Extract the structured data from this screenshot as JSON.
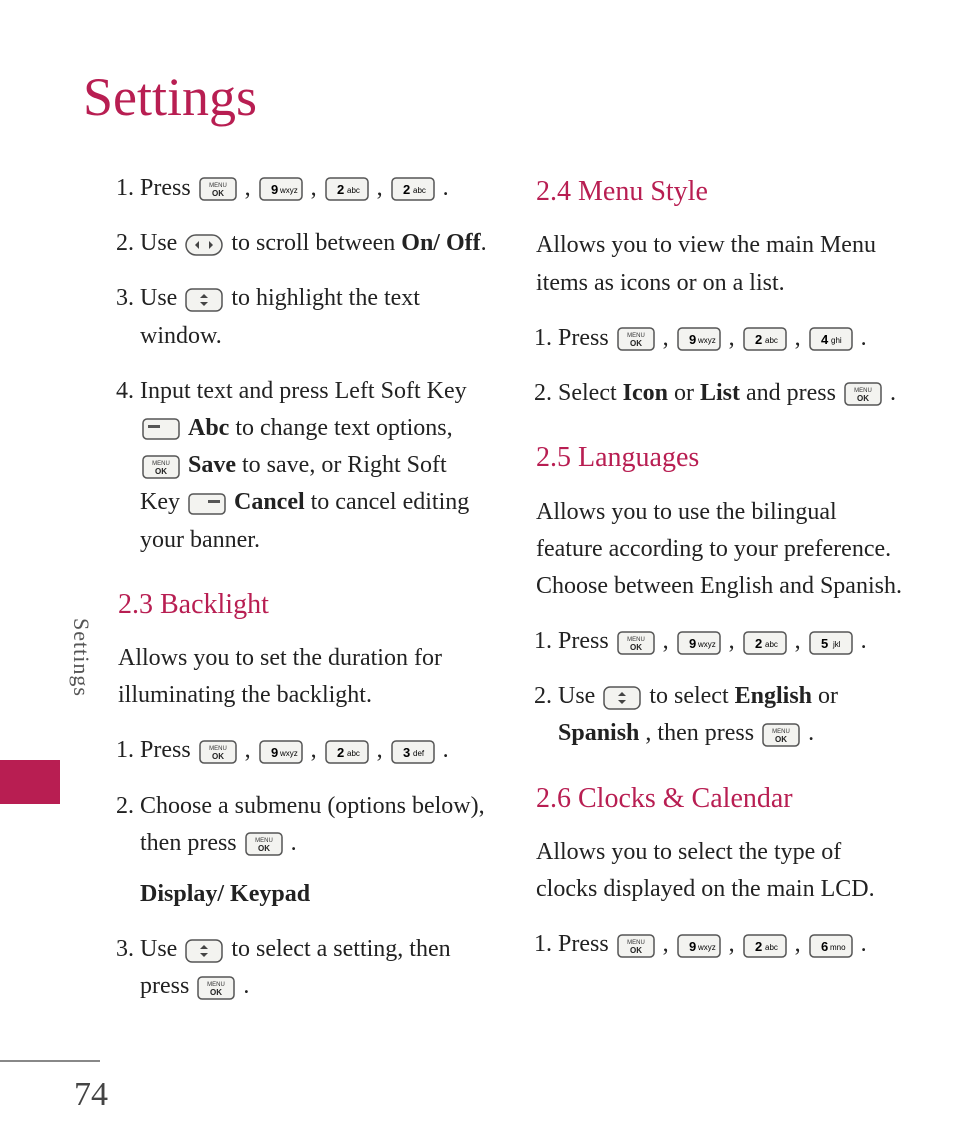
{
  "page": {
    "title": "Settings",
    "sidebar_label": "Settings",
    "page_number": "74"
  },
  "col_left": {
    "steps_initial": {
      "s1_a": "Press ",
      "s1_b": " , ",
      "s1_c": " , ",
      "s1_d": " , ",
      "s1_e": " .",
      "s2_a": "Use ",
      "s2_b": " to scroll between ",
      "s2_bold": "On/ Off",
      "s2_c": ".",
      "s3_a": "Use ",
      "s3_b": " to highlight the text window.",
      "s4_a": "Input text and press Left Soft Key ",
      "s4_b": " ",
      "s4_abc": "Abc",
      "s4_c": " to change text options, ",
      "s4_d": " ",
      "s4_save": "Save",
      "s4_e": " to save, or Right Soft Key ",
      "s4_f": " ",
      "s4_cancel": "Cancel",
      "s4_g": " to cancel editing your banner."
    },
    "sec_backlight": {
      "heading": "2.3 Backlight",
      "intro": "Allows you to set the duration for illuminating the backlight.",
      "s1_a": "Press ",
      "s1_b": " , ",
      "s1_c": " , ",
      "s1_d": " , ",
      "s1_e": " .",
      "s2_a": "Choose a submenu (options below), then press ",
      "s2_b": " .",
      "s2_sub": "Display/ Keypad",
      "s3_a": "Use ",
      "s3_b": " to select a setting, then press ",
      "s3_c": " ."
    }
  },
  "col_right": {
    "sec_menu": {
      "heading": "2.4 Menu Style",
      "intro": "Allows you to view the main Menu items as icons or on a list.",
      "s1_a": "Press ",
      "s1_b": " , ",
      "s1_c": " , ",
      "s1_d": " , ",
      "s1_e": " .",
      "s2_a": "Select ",
      "s2_icon": "Icon",
      "s2_or": " or ",
      "s2_list": "List",
      "s2_b": " and press ",
      "s2_c": " ."
    },
    "sec_lang": {
      "heading": "2.5 Languages",
      "intro": "Allows you to use the bilingual feature according to your preference. Choose between English and Spanish.",
      "s1_a": "Press ",
      "s1_b": " , ",
      "s1_c": " , ",
      "s1_d": " , ",
      "s1_e": " .",
      "s2_a": "Use ",
      "s2_b": " to select ",
      "s2_eng": "English",
      "s2_or": " or ",
      "s2_spa": "Spanish",
      "s2_c": ", then press ",
      "s2_d": " ."
    },
    "sec_clock": {
      "heading": "2.6 Clocks & Calendar",
      "intro": "Allows you to select the type of clocks displayed on the main LCD.",
      "s1_a": "Press ",
      "s1_b": " , ",
      "s1_c": " , ",
      "s1_d": " , ",
      "s1_e": " ."
    }
  },
  "keys": {
    "menu_ok": "MENU OK",
    "9": "9 wxyz",
    "2": "2 abc",
    "3": "3 def",
    "4": "4 ghi",
    "5": "5 jkl",
    "6": "6 mno",
    "nav_lr": "left-right",
    "nav_ud": "up-down",
    "soft_left": "left soft key",
    "soft_right": "right soft key"
  }
}
